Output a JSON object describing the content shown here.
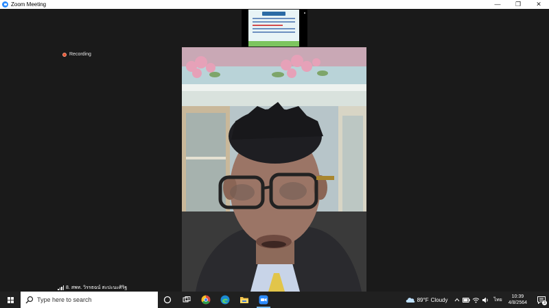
{
  "window": {
    "title": "Zoom Meeting",
    "controls": {
      "minimize": "—",
      "restore": "❐",
      "close": "✕"
    }
  },
  "meeting": {
    "recording_label": "Recording",
    "participant_name": "8. สพท. วิรรธฉน์ สะปะนะศิริฐ",
    "accent_color": "#2d8cff",
    "recording_color": "#e8512f"
  },
  "taskbar": {
    "search_placeholder": "Type here to search",
    "pinned": [
      "task-view-icon",
      "chrome-icon",
      "edge-icon",
      "file-explorer-icon",
      "zoom-icon"
    ],
    "weather": {
      "temp": "89°F",
      "condition": "Cloudy"
    },
    "language": "ไทย",
    "clock": {
      "time": "10:39",
      "date": "4/8/2564"
    },
    "notification_count": "3"
  }
}
